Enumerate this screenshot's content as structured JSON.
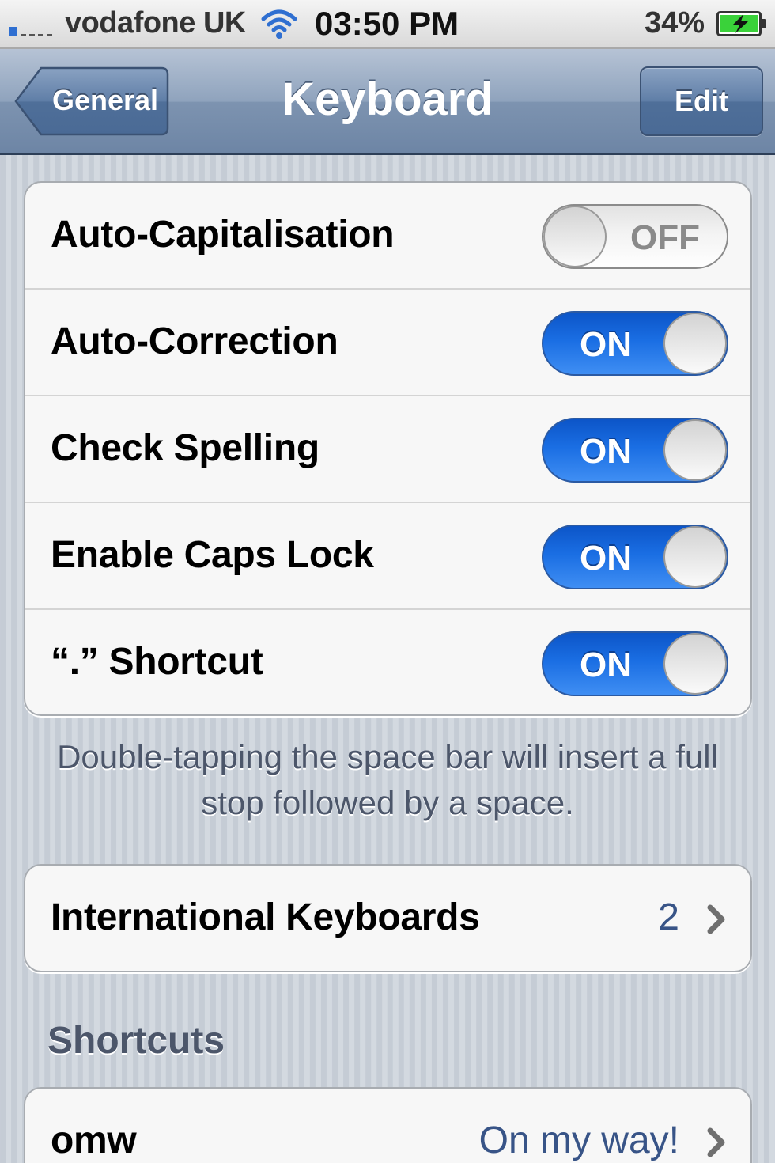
{
  "status_bar": {
    "carrier": "vodafone UK",
    "time": "03:50 PM",
    "battery_percent": "34%",
    "signal_icon": "signal-icon",
    "wifi_icon": "wifi-icon",
    "battery_icon": "battery-charging-icon",
    "signal_color": "#2f6fd1",
    "battery_color": "#3ad23a"
  },
  "nav_bar": {
    "title": "Keyboard",
    "back_label": "General",
    "edit_label": "Edit"
  },
  "settings": [
    {
      "label": "Auto-Capitalisation",
      "state": "OFF"
    },
    {
      "label": "Auto-Correction",
      "state": "ON"
    },
    {
      "label": "Check Spelling",
      "state": "ON"
    },
    {
      "label": "Enable Caps Lock",
      "state": "ON"
    },
    {
      "label": "“.” Shortcut",
      "state": "ON"
    }
  ],
  "shortcut_note": "Double-tapping the space bar will insert a full stop followed by a space.",
  "international": {
    "label": "International Keyboards",
    "value": "2"
  },
  "shortcuts_section": {
    "header": "Shortcuts",
    "items": [
      {
        "label": "omw",
        "value": "On my way!"
      }
    ]
  },
  "colors": {
    "toggle_on": "#1a6ee3",
    "value_text": "#385487",
    "nav_bar": "#7d93b0"
  }
}
